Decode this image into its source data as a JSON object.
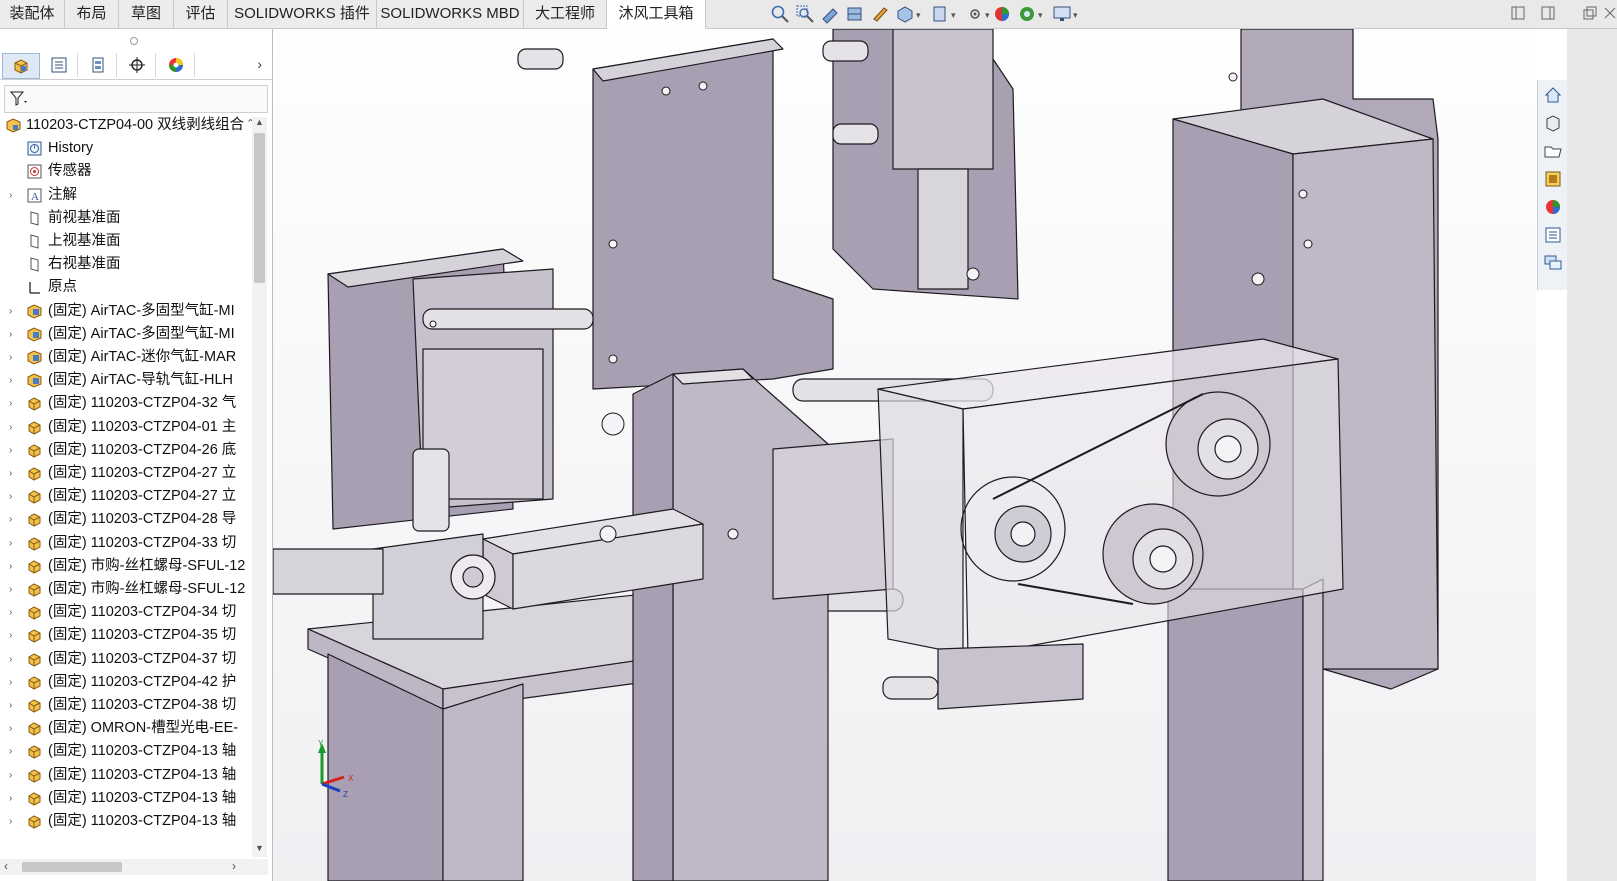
{
  "tabs": [
    {
      "label": "装配体",
      "active": false
    },
    {
      "label": "布局",
      "active": false
    },
    {
      "label": "草图",
      "active": false
    },
    {
      "label": "评估",
      "active": false
    },
    {
      "label": "SOLIDWORKS 插件",
      "active": false
    },
    {
      "label": "SOLIDWORKS MBD",
      "active": false
    },
    {
      "label": "大工程师",
      "active": false
    },
    {
      "label": "沐风工具箱",
      "active": true
    }
  ],
  "hud_icons": [
    "zoom-to-fit-icon",
    "zoom-area-icon",
    "previous-view-icon",
    "section-view-icon",
    "view-orientation-icon",
    "display-style-icon",
    "hide-show-icon",
    "edit-appearance-icon",
    "apply-scene-icon",
    "view-settings-icon"
  ],
  "manager_tabs": [
    "featuremanager-icon",
    "propertymanager-icon",
    "configurationmanager-icon",
    "dimxpertmanager-icon",
    "displaymanager-icon"
  ],
  "tree": {
    "root": "110203-CTZP04-00 双线剥线组合",
    "items": [
      {
        "label": "History",
        "icon": "history",
        "expandable": false
      },
      {
        "label": "传感器",
        "icon": "sensor",
        "expandable": false
      },
      {
        "label": "注解",
        "icon": "annotation",
        "expandable": true
      },
      {
        "label": "前视基准面",
        "icon": "plane",
        "expandable": false
      },
      {
        "label": "上视基准面",
        "icon": "plane",
        "expandable": false
      },
      {
        "label": "右视基准面",
        "icon": "plane",
        "expandable": false
      },
      {
        "label": "原点",
        "icon": "origin",
        "expandable": false
      },
      {
        "label": "(固定) AirTAC-多固型气缸-MI",
        "icon": "subassembly",
        "expandable": true
      },
      {
        "label": "(固定) AirTAC-多固型气缸-MI",
        "icon": "subassembly",
        "expandable": true
      },
      {
        "label": "(固定) AirTAC-迷你气缸-MAR",
        "icon": "subassembly",
        "expandable": true
      },
      {
        "label": "(固定) AirTAC-导轨气缸-HLH",
        "icon": "subassembly",
        "expandable": true
      },
      {
        "label": "(固定) 110203-CTZP04-32 气",
        "icon": "part",
        "expandable": true
      },
      {
        "label": "(固定) 110203-CTZP04-01 主",
        "icon": "part",
        "expandable": true
      },
      {
        "label": "(固定) 110203-CTZP04-26 底",
        "icon": "part",
        "expandable": true
      },
      {
        "label": "(固定) 110203-CTZP04-27 立",
        "icon": "part",
        "expandable": true
      },
      {
        "label": "(固定) 110203-CTZP04-27 立",
        "icon": "part",
        "expandable": true
      },
      {
        "label": "(固定) 110203-CTZP04-28 导",
        "icon": "part",
        "expandable": true
      },
      {
        "label": "(固定) 110203-CTZP04-33 切",
        "icon": "part",
        "expandable": true
      },
      {
        "label": "(固定) 市购-丝杠螺母-SFUL-12",
        "icon": "part",
        "expandable": true
      },
      {
        "label": "(固定) 市购-丝杠螺母-SFUL-12",
        "icon": "part",
        "expandable": true
      },
      {
        "label": "(固定) 110203-CTZP04-34 切",
        "icon": "part",
        "expandable": true
      },
      {
        "label": "(固定) 110203-CTZP04-35 切",
        "icon": "part",
        "expandable": true
      },
      {
        "label": "(固定) 110203-CTZP04-37 切",
        "icon": "part",
        "expandable": true
      },
      {
        "label": "(固定) 110203-CTZP04-42 护",
        "icon": "part",
        "expandable": true
      },
      {
        "label": "(固定) 110203-CTZP04-38 切",
        "icon": "part",
        "expandable": true
      },
      {
        "label": "(固定) OMRON-槽型光电-EE-",
        "icon": "part",
        "expandable": true
      },
      {
        "label": "(固定) 110203-CTZP04-13 轴",
        "icon": "part",
        "expandable": true
      },
      {
        "label": "(固定) 110203-CTZP04-13 轴",
        "icon": "part",
        "expandable": true
      },
      {
        "label": "(固定) 110203-CTZP04-13 轴",
        "icon": "part",
        "expandable": true
      },
      {
        "label": "(固定) 110203-CTZP04-13 轴",
        "icon": "part",
        "expandable": true
      }
    ]
  },
  "triad": {
    "x": "X",
    "y": "Y",
    "z": "Z"
  },
  "task_pane": [
    "home-icon",
    "design-library-icon",
    "file-explorer-icon",
    "view-palette-icon",
    "appearances-icon",
    "custom-properties-icon",
    "forum-icon"
  ],
  "colors": {
    "model_fill": "#a99fb2",
    "model_face": "#d7d3da",
    "model_edge": "#1d1b20",
    "accent": "#1e5fa8"
  }
}
